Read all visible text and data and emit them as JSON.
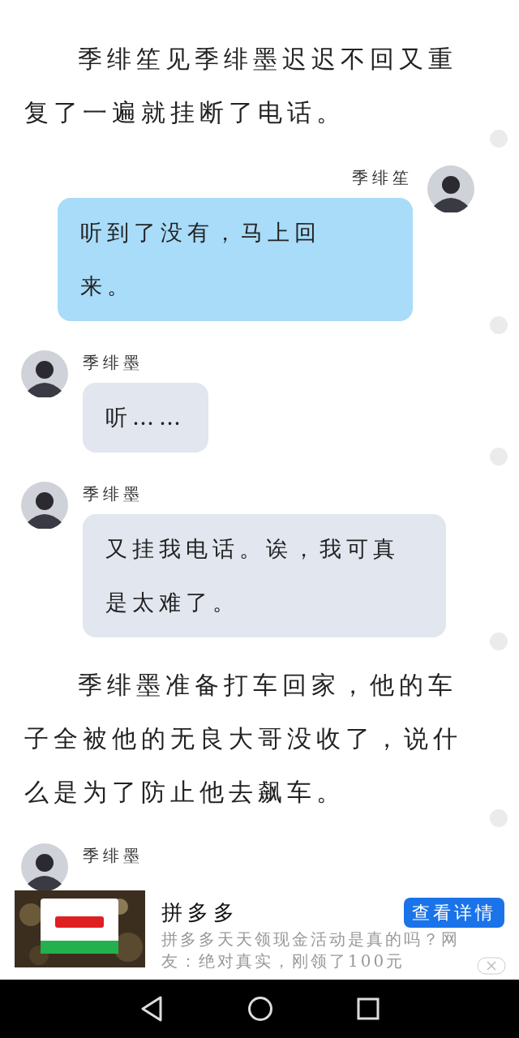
{
  "blocks": [
    {
      "kind": "narration",
      "text": "季绯笙见季绯墨迟迟不回又重复了一遍就挂断了电话。"
    },
    {
      "kind": "message_right",
      "sender": "季绯笙",
      "text": "听到了没有，马上回来。"
    },
    {
      "kind": "message_left",
      "sender": "季绯墨",
      "text": "听……"
    },
    {
      "kind": "message_left",
      "sender": "季绯墨",
      "text": "又挂我电话。诶，我可真是太难了。"
    },
    {
      "kind": "narration",
      "text": "季绯墨准备打车回家，他的车子全被他的无良大哥没收了，说什么是为了防止他去飙车。"
    },
    {
      "kind": "message_left",
      "sender": "季绯墨"
    }
  ],
  "ad": {
    "kind": "picture",
    "title": "拼多多",
    "button": "查看详情",
    "description": "拼多多天天领现金活动是真的吗？网友：绝对真实，刚领了100元"
  }
}
